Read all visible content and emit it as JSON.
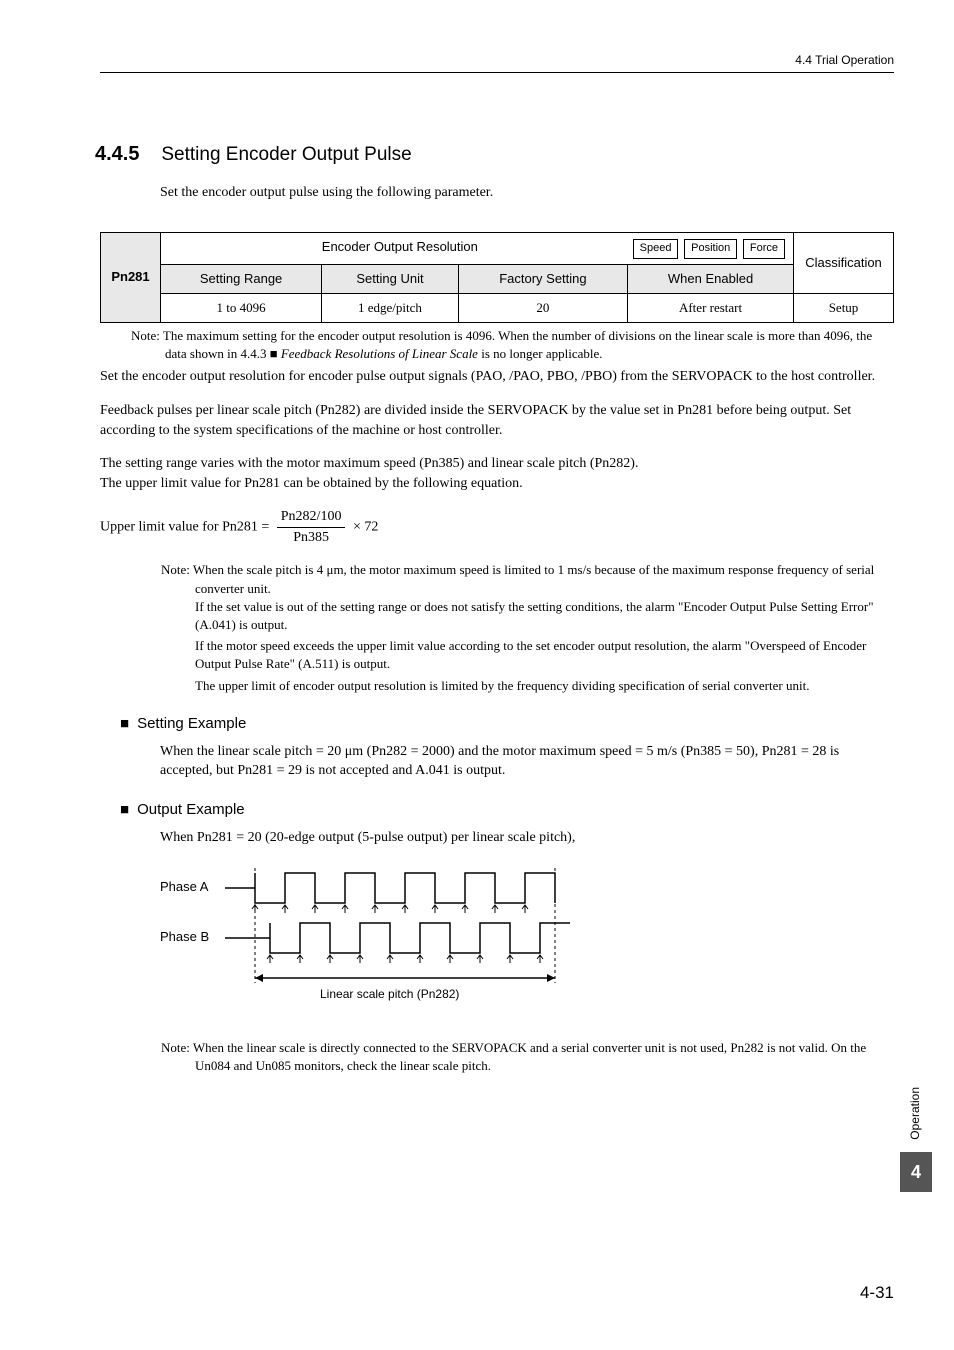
{
  "header": {
    "right": "4.4  Trial Operation"
  },
  "section": {
    "number": "4.4.5",
    "title": "Setting Encoder Output Pulse"
  },
  "intro": "Set the encoder output pulse using the following parameter.",
  "table": {
    "pn": "Pn281",
    "param_name": "Encoder Output Resolution",
    "badges": [
      "Speed",
      "Position",
      "Force"
    ],
    "classification_label": "Classification",
    "headers": {
      "range": "Setting Range",
      "unit": "Setting Unit",
      "factory": "Factory Setting",
      "enabled": "When Enabled"
    },
    "values": {
      "range": "1 to 4096",
      "unit": "1 edge/pitch",
      "factory": "20",
      "enabled": "After restart",
      "classification": "Setup"
    }
  },
  "note1_label": "Note:",
  "note1": "The maximum setting for the encoder output resolution is 4096. When the number of divisions on the linear scale is more than 4096, the data shown in 4.4.3 ",
  "note1_ref": "Feedback Resolutions of Linear Scale",
  "note1_end": " is no longer applicable.",
  "para1": "Set the encoder output resolution for encoder pulse output signals (PAO, /PAO, PBO, /PBO) from the SERVOPACK to the host controller.",
  "para2": "Feedback pulses per linear scale pitch (Pn282) are divided inside the SERVOPACK by the value set in Pn281 before being output. Set according to the system specifications of the machine or host controller.",
  "para3a": "The setting range varies with the motor maximum speed (Pn385) and linear scale pitch (Pn282).",
  "para3b": "The upper limit value for Pn281 can be obtained by the following equation.",
  "equation": {
    "lhs": "Upper limit value for Pn281 = ",
    "num": "Pn282/100",
    "den": "Pn385",
    "rhs": " × 72"
  },
  "note2_label": "Note:",
  "note2a": "When the scale pitch is 4 μm, the motor maximum speed is limited to 1 ms/s because of the maximum response frequency of serial converter unit.",
  "note2b": "If the set value is out of the setting range or does not satisfy the setting conditions, the alarm \"Encoder Output Pulse Setting Error\" (A.041) is output.",
  "note2c": "If the motor speed exceeds the upper limit value according to the set encoder output resolution, the alarm \"Overspeed of Encoder Output Pulse Rate\" (A.511) is output.",
  "note2d": "The upper limit of encoder output resolution is limited by the frequency dividing specification of serial converter unit.",
  "setting_example": {
    "heading": "Setting Example",
    "text": "When the linear scale pitch = 20 μm (Pn282 = 2000) and the motor maximum speed = 5 m/s (Pn385 = 50), Pn281 = 28 is accepted, but Pn281 = 29 is not accepted and A.041 is output."
  },
  "output_example": {
    "heading": "Output Example",
    "text": "When Pn281 = 20 (20-edge output (5-pulse output) per linear scale pitch),",
    "phase_a": "Phase A",
    "phase_b": "Phase B",
    "pitch_label": "Linear scale pitch (Pn282)"
  },
  "note3_label": "Note:",
  "note3": "When the linear scale is directly connected to the SERVOPACK and a serial converter unit is not used, Pn282 is not valid. On the Un084 and Un085 monitors, check the linear scale pitch.",
  "side": {
    "operation": "Operation",
    "chapter": "4"
  },
  "page_number": "4-31"
}
